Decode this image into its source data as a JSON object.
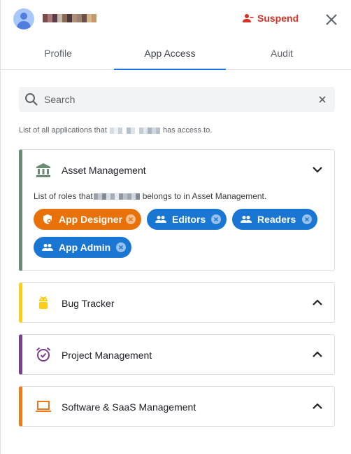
{
  "header": {
    "suspend_label": "Suspend"
  },
  "tabs": [
    {
      "label": "Profile"
    },
    {
      "label": "App Access"
    },
    {
      "label": "Audit"
    }
  ],
  "search": {
    "placeholder": "Search"
  },
  "description": {
    "prefix": "List of all applications that",
    "suffix": "has access to."
  },
  "apps": [
    {
      "title": "Asset Management",
      "accent_color": "#6d8a74",
      "icon": "bank-icon",
      "expanded": true,
      "roles_prefix": "List of roles that",
      "roles_suffix": "belongs to in Asset Management.",
      "roles": [
        {
          "label": "App Designer",
          "color": "#e8710a",
          "icon": "shield-icon"
        },
        {
          "label": "Editors",
          "color": "#1976d2",
          "icon": "group-icon"
        },
        {
          "label": "Readers",
          "color": "#1976d2",
          "icon": "group-icon"
        },
        {
          "label": "App Admin",
          "color": "#1976d2",
          "icon": "group-icon"
        }
      ]
    },
    {
      "title": "Bug Tracker",
      "accent_color": "#f9cf1a",
      "icon": "android-icon",
      "expanded": false
    },
    {
      "title": "Project Management",
      "accent_color": "#7b3f8c",
      "icon": "alarm-icon",
      "expanded": false
    },
    {
      "title": "Software & SaaS Management",
      "accent_color": "#f07a1a",
      "icon": "laptop-icon",
      "expanded": false
    }
  ]
}
